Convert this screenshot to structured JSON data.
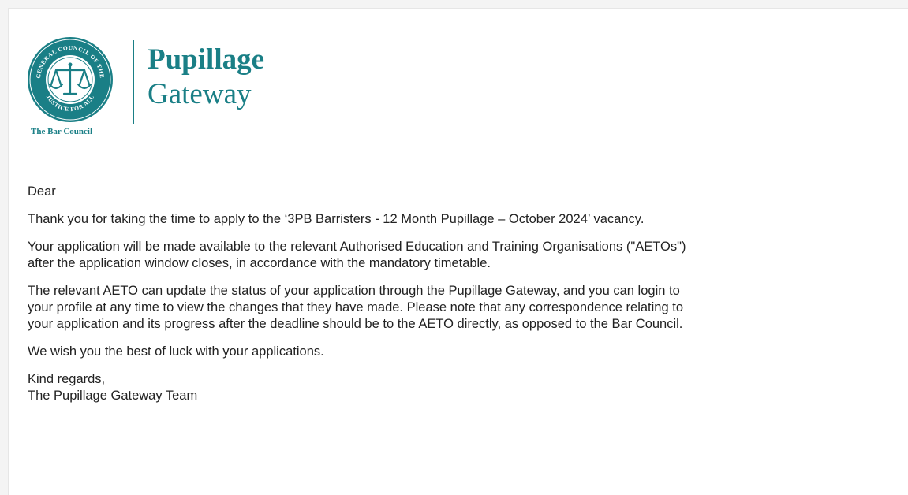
{
  "logo": {
    "seal_text": "THE GENERAL COUNCIL OF THE BAR",
    "seal_motto": "JUSTICE FOR ALL",
    "org_name": "The Bar Council",
    "brand_line1": "Pupillage",
    "brand_line2": "Gateway",
    "color": "#1a7f86"
  },
  "email": {
    "greeting": "Dear",
    "para1": "Thank you for taking the time to apply to the ‘3PB Barristers - 12 Month Pupillage – October 2024’ vacancy.",
    "para2_line1": "Your application will be made available to the relevant Authorised Education and Training Organisations (\"AETOs\")",
    "para2_line2": "after the application window closes, in accordance with the mandatory timetable.",
    "para3_line1": "The relevant AETO can update the status of your application through the Pupillage Gateway, and you can login to",
    "para3_line2": "your profile at any time to view the changes that they have made. Please note that any correspondence relating to",
    "para3_line3": "your application and its progress after the deadline should be to the AETO directly, as opposed to the Bar Council.",
    "para4": "We wish you the best of luck with your applications.",
    "signoff": "Kind regards,",
    "signature": "The Pupillage Gateway Team"
  }
}
